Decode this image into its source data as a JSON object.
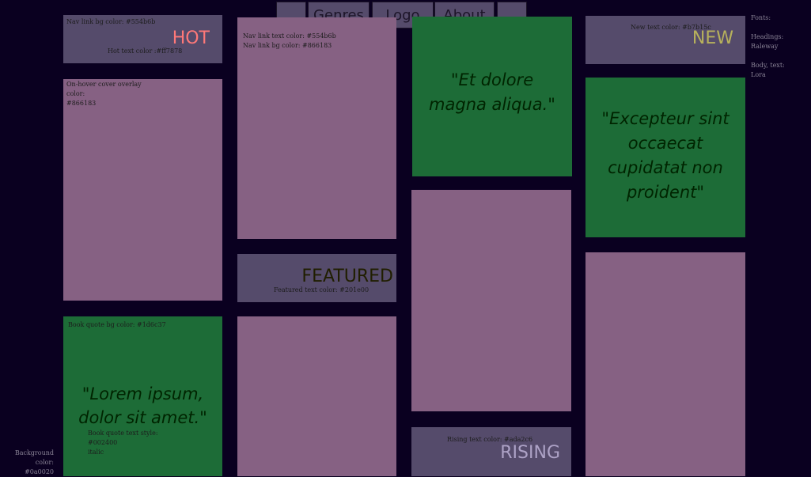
{
  "colors": {
    "background": "#0a0020",
    "nav_link_bg": "#554b6b",
    "cover_overlay": "#866183",
    "quote_bg": "#1d6c37",
    "quote_text": "#002400",
    "hot_text": "#ff7878",
    "new_text": "#b7b15c",
    "featured_text": "#201e00",
    "rising_text": "#ada2c6"
  },
  "nav": {
    "items": [
      "",
      "Genres",
      "Logo",
      "About",
      ""
    ]
  },
  "tiles": {
    "hot": {
      "note_top": "Nav link bg color: #554b6b",
      "label": "HOT",
      "note_bottom": "Hot text color :#ff7878"
    },
    "cover_overlay": {
      "note_line1": "On-hover cover overlay",
      "note_line2": "color:",
      "note_line3": "#866183"
    },
    "book_quote_1": {
      "note": "Book quote bg color: #1d6c37",
      "quote_line1": "\"Lorem ipsum,",
      "quote_line2": "dolor sit amet.\"",
      "style_line1": "Book quote text style:",
      "style_line2": "#002400",
      "style_line3": "italic"
    },
    "nav_text": {
      "note_line1": "Nav link text color: #554b6b",
      "note_line2": "Nav link bg color: #866183"
    },
    "featured": {
      "label": "FEATURED",
      "note": "Featured text color: #201e00"
    },
    "book_quote_2": {
      "quote_line1": "\"Et dolore",
      "quote_line2": "magna aliqua.\""
    },
    "rising": {
      "note": "Rising text color: #ada2c6",
      "label": "RISING"
    },
    "new": {
      "note": "New text color: #b7b15c",
      "label": "NEW"
    },
    "book_quote_3": {
      "quote_line1": "\"Excepteur sint",
      "quote_line2": "occaecat",
      "quote_line3": "cupidatat non",
      "quote_line4": "proident\""
    }
  },
  "side_notes": {
    "background_line1": "Background",
    "background_line2": "color:",
    "background_line3": "#0a0020",
    "fonts_title": "Fonts:",
    "headings_label": "Headings:",
    "headings_font": "Raleway",
    "body_label": "Body, text:",
    "body_font": "Lora"
  }
}
